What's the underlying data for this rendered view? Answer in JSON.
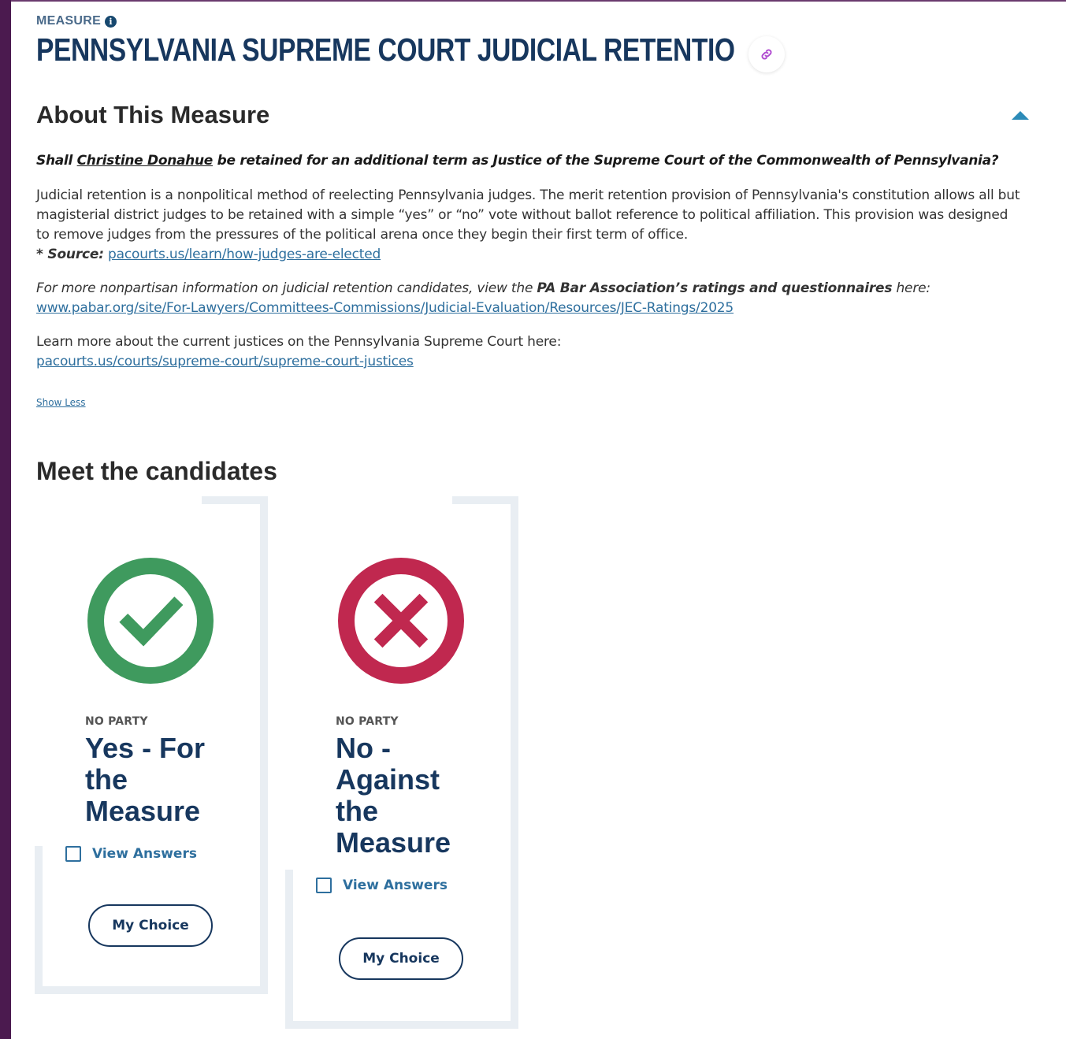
{
  "header": {
    "eyebrow": "MEASURE",
    "info_icon": "i",
    "title": "PENNSYLVANIA SUPREME COURT JUDICIAL RETENTION ELECTION I",
    "link_icon": "link-icon"
  },
  "about": {
    "heading": "About This Measure",
    "question_prefix": "Shall ",
    "question_name": "Christine Donahue",
    "question_suffix": " be retained for an additional term as Justice of the Supreme Court of the Commonwealth of Pennsylvania?",
    "para1": "Judicial retention is a nonpolitical method of reelecting Pennsylvania judges. The merit retention provision of Pennsylvania's constitution allows all but magisterial district judges to be retained with a simple “yes” or “no” vote without ballot reference to political affiliation. This provision was designed to remove judges from the pressures of the political arena once they begin their first term of office.",
    "source_label": "* Source:",
    "source_link": "pacourts.us/learn/how-judges-are-elected",
    "para2_prefix": "For more nonpartisan information on judicial retention candidates, view the ",
    "para2_bold": "PA Bar Association’s ratings and questionnaires",
    "para2_suffix": " here:",
    "para2_link": "www.pabar.org/site/For-Lawyers/Committees-Commissions/Judicial-Evaluation/Resources/JEC-Ratings/2025",
    "para3_text": "Learn more about the current justices on the Pennsylvania Supreme Court here:",
    "para3_link": "pacourts.us/courts/supreme-court/supreme-court-justices",
    "show_less": "Show Less"
  },
  "candidates": {
    "heading": "Meet the candidates",
    "items": [
      {
        "party": "NO PARTY",
        "name": "Yes - For the Measure",
        "view_answers": "View Answers",
        "choice": "My Choice",
        "icon": "check-icon",
        "color": "#3f9a5e"
      },
      {
        "party": "NO PARTY",
        "name": "No - Against the Measure",
        "view_answers": "View Answers",
        "choice": "My Choice",
        "icon": "x-icon",
        "color": "#c0284f"
      }
    ]
  },
  "colors": {
    "title": "#17375e",
    "link": "#2e6f9e",
    "stripe": "#4b1a4f"
  }
}
